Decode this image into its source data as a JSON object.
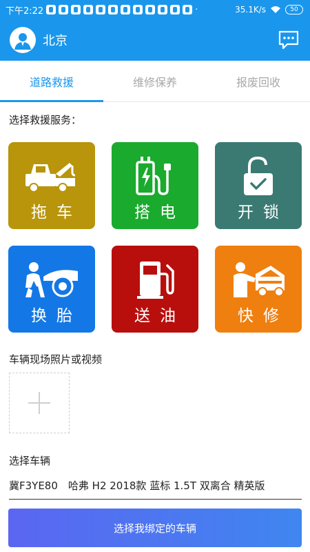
{
  "status_bar": {
    "time": "下午2:22",
    "network_speed": "35.1K/s",
    "battery": "50",
    "icons": [
      "tiktok-icon",
      "tiktok-icon",
      "trash-icon",
      "tiktok-icon",
      "mi-icon",
      "tiktok-icon",
      "pocket-icon",
      "tiktok-icon",
      "tiktok-icon",
      "tiktok-icon",
      "browser-icon",
      "tiktok-icon",
      "dots-icon"
    ]
  },
  "header": {
    "city": "北京",
    "avatar_icon": "user-avatar-icon",
    "message_icon": "chat-icon"
  },
  "tabs": [
    {
      "label": "道路救援",
      "active": true
    },
    {
      "label": "维修保养",
      "active": false
    },
    {
      "label": "报废回收",
      "active": false
    }
  ],
  "services": {
    "title": "选择救援服务：",
    "items": [
      {
        "label": "拖车",
        "icon": "tow-truck-icon",
        "color": "#b8950a"
      },
      {
        "label": "搭电",
        "icon": "battery-plug-icon",
        "color": "#1aaa2d"
      },
      {
        "label": "开锁",
        "icon": "unlock-icon",
        "color": "#3a7a73"
      },
      {
        "label": "换胎",
        "icon": "tire-change-icon",
        "color": "#1378e6"
      },
      {
        "label": "送油",
        "icon": "fuel-pump-icon",
        "color": "#b80f0d"
      },
      {
        "label": "快修",
        "icon": "mechanic-icon",
        "color": "#ef7f0f"
      }
    ]
  },
  "media": {
    "title": "车辆现场照片或视频",
    "add_icon": "plus-icon"
  },
  "vehicle": {
    "title": "选择车辆",
    "value": "冀F3YE80　哈弗 H2 2018款 蓝标 1.5T 双离合 精英版"
  },
  "actions": {
    "bind_button": "选择我绑定的车辆"
  },
  "colors": {
    "primary": "#1a97ec",
    "button_gradient_start": "#5b66f1",
    "button_gradient_end": "#3f86f0"
  }
}
